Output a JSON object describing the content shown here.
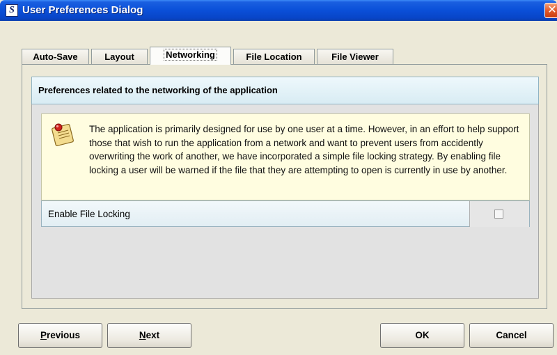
{
  "window": {
    "title": "User Preferences Dialog",
    "app_icon_letter": "S",
    "close_glyph": "✕"
  },
  "tabs": [
    {
      "label": "Auto-Save",
      "active": false
    },
    {
      "label": "Layout",
      "active": false
    },
    {
      "label": "Networking",
      "active": true
    },
    {
      "label": "File Location",
      "active": false
    },
    {
      "label": "File Viewer",
      "active": false
    }
  ],
  "panel": {
    "header": "Preferences related to the networking of the application",
    "info_icon": "note-icon",
    "info_text": "The application is primarily designed for use by one user at a time. However, in an effort to help support those that wish to run the application from a network and want to prevent users from accidently overwriting the work of another, we have incorporated a simple file locking strategy. By enabling file locking a user will be warned if the file that they are attempting to open is currently in use by another.",
    "setting": {
      "label": "Enable File Locking",
      "checked": false
    }
  },
  "buttons": {
    "previous": {
      "mnemonic": "P",
      "rest": "revious"
    },
    "next": {
      "mnemonic": "N",
      "rest": "ext"
    },
    "ok": "OK",
    "cancel": "Cancel"
  },
  "colors": {
    "titlebar": "#0a4fd8",
    "header_bar": "#d8ecf3",
    "info_box": "#fffde0"
  }
}
